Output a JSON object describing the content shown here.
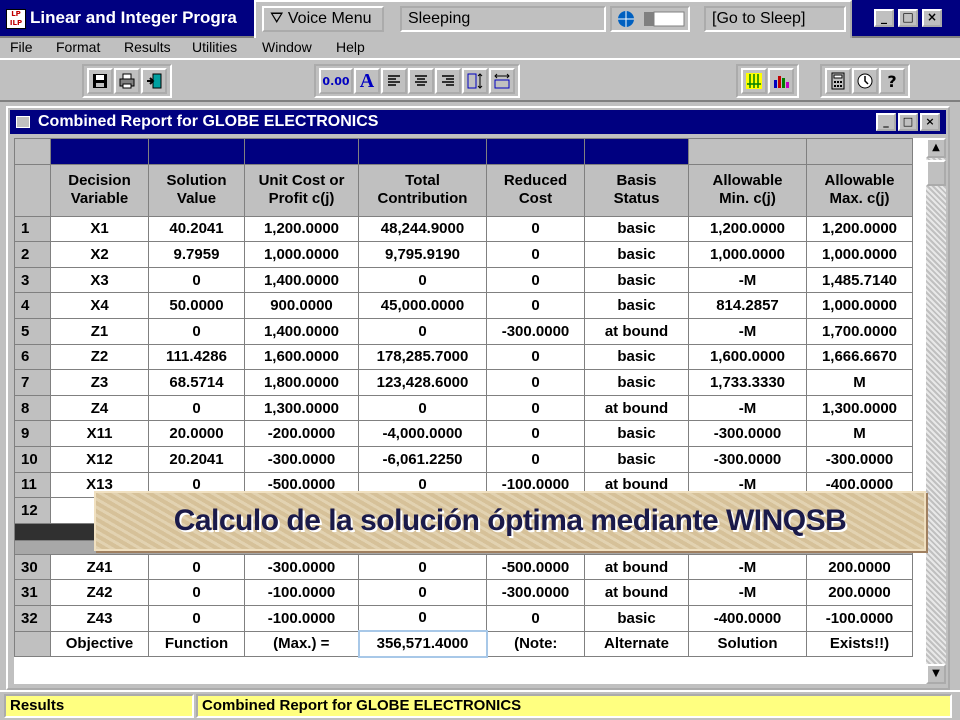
{
  "app": {
    "title": "Linear and Integer Progra",
    "icon_label": "LP ILP",
    "controls": {
      "minimize": "_",
      "maximize": "□",
      "close": "×"
    }
  },
  "voice": {
    "menu_label": "⛛ Voice Menu",
    "status": "Sleeping",
    "command": "[Go to Sleep]"
  },
  "menu": {
    "items": [
      "File",
      "Format",
      "Results",
      "Utilities",
      "Window",
      "Help"
    ]
  },
  "toolbar": {
    "icons": [
      "save-icon",
      "print-icon",
      "exit-icon",
      "decimal-icon",
      "font-icon",
      "align-left-icon",
      "align-center-icon",
      "align-right-icon",
      "column-width-icon",
      "row-height-icon",
      "grid-icon",
      "bar-chart-icon",
      "calculator-icon",
      "clock-icon",
      "help-icon"
    ],
    "decimal_label": "0.00",
    "font_label": "A",
    "help_label": "?"
  },
  "report": {
    "window_title": "Combined Report for GLOBE ELECTRONICS",
    "columns": [
      [
        "Decision",
        "Variable"
      ],
      [
        "Solution",
        "Value"
      ],
      [
        "Unit Cost or",
        "Profit c(j)"
      ],
      [
        "Total",
        "Contribution"
      ],
      [
        "Reduced",
        "Cost"
      ],
      [
        "Basis",
        "Status"
      ],
      [
        "Allowable",
        "Min. c(j)"
      ],
      [
        "Allowable",
        "Max. c(j)"
      ]
    ],
    "rows_top": [
      {
        "n": "1",
        "cells": [
          "X1",
          "40.2041",
          "1,200.0000",
          "48,244.9000",
          "0",
          "basic",
          "1,200.0000",
          "1,200.0000"
        ]
      },
      {
        "n": "2",
        "cells": [
          "X2",
          "9.7959",
          "1,000.0000",
          "9,795.9190",
          "0",
          "basic",
          "1,000.0000",
          "1,000.0000"
        ]
      },
      {
        "n": "3",
        "cells": [
          "X3",
          "0",
          "1,400.0000",
          "0",
          "0",
          "basic",
          "-M",
          "1,485.7140"
        ]
      },
      {
        "n": "4",
        "cells": [
          "X4",
          "50.0000",
          "900.0000",
          "45,000.0000",
          "0",
          "basic",
          "814.2857",
          "1,000.0000"
        ]
      },
      {
        "n": "5",
        "cells": [
          "Z1",
          "0",
          "1,400.0000",
          "0",
          "-300.0000",
          "at bound",
          "-M",
          "1,700.0000"
        ]
      },
      {
        "n": "6",
        "cells": [
          "Z2",
          "111.4286",
          "1,600.0000",
          "178,285.7000",
          "0",
          "basic",
          "1,600.0000",
          "1,666.6670"
        ]
      },
      {
        "n": "7",
        "cells": [
          "Z3",
          "68.5714",
          "1,800.0000",
          "123,428.6000",
          "0",
          "basic",
          "1,733.3330",
          "M"
        ]
      },
      {
        "n": "8",
        "cells": [
          "Z4",
          "0",
          "1,300.0000",
          "0",
          "0",
          "at bound",
          "-M",
          "1,300.0000"
        ]
      },
      {
        "n": "9",
        "cells": [
          "X11",
          "20.0000",
          "-200.0000",
          "-4,000.0000",
          "0",
          "basic",
          "-300.0000",
          "M"
        ]
      },
      {
        "n": "10",
        "cells": [
          "X12",
          "20.2041",
          "-300.0000",
          "-6,061.2250",
          "0",
          "basic",
          "-300.0000",
          "-300.0000"
        ]
      },
      {
        "n": "11",
        "cells": [
          "X13",
          "0",
          "-500.0000",
          "0",
          "-100.0000",
          "at bound",
          "-M",
          "-400.0000"
        ]
      },
      {
        "n": "12",
        "cells": [
          "X",
          "",
          "",
          "",
          "",
          "",
          "",
          ""
        ]
      }
    ],
    "rows_bottom": [
      {
        "n": "30",
        "cells": [
          "Z41",
          "0",
          "-300.0000",
          "0",
          "-500.0000",
          "at bound",
          "-M",
          "200.0000"
        ]
      },
      {
        "n": "31",
        "cells": [
          "Z42",
          "0",
          "-100.0000",
          "0",
          "-300.0000",
          "at bound",
          "-M",
          "200.0000"
        ]
      },
      {
        "n": "32",
        "cells": [
          "Z43",
          "0",
          "-100.0000",
          "0",
          "0",
          "basic",
          "-400.0000",
          "-100.0000"
        ]
      }
    ],
    "objective_row": [
      "Objective",
      "Function",
      "(Max.) =",
      "356,571.4000",
      "(Note:",
      "Alternate",
      "Solution",
      "Exists!!)"
    ]
  },
  "status": {
    "left": "Results",
    "right": "Combined Report for GLOBE ELECTRONICS"
  },
  "caption": "Calculo de la solución óptima mediante WINQSB"
}
